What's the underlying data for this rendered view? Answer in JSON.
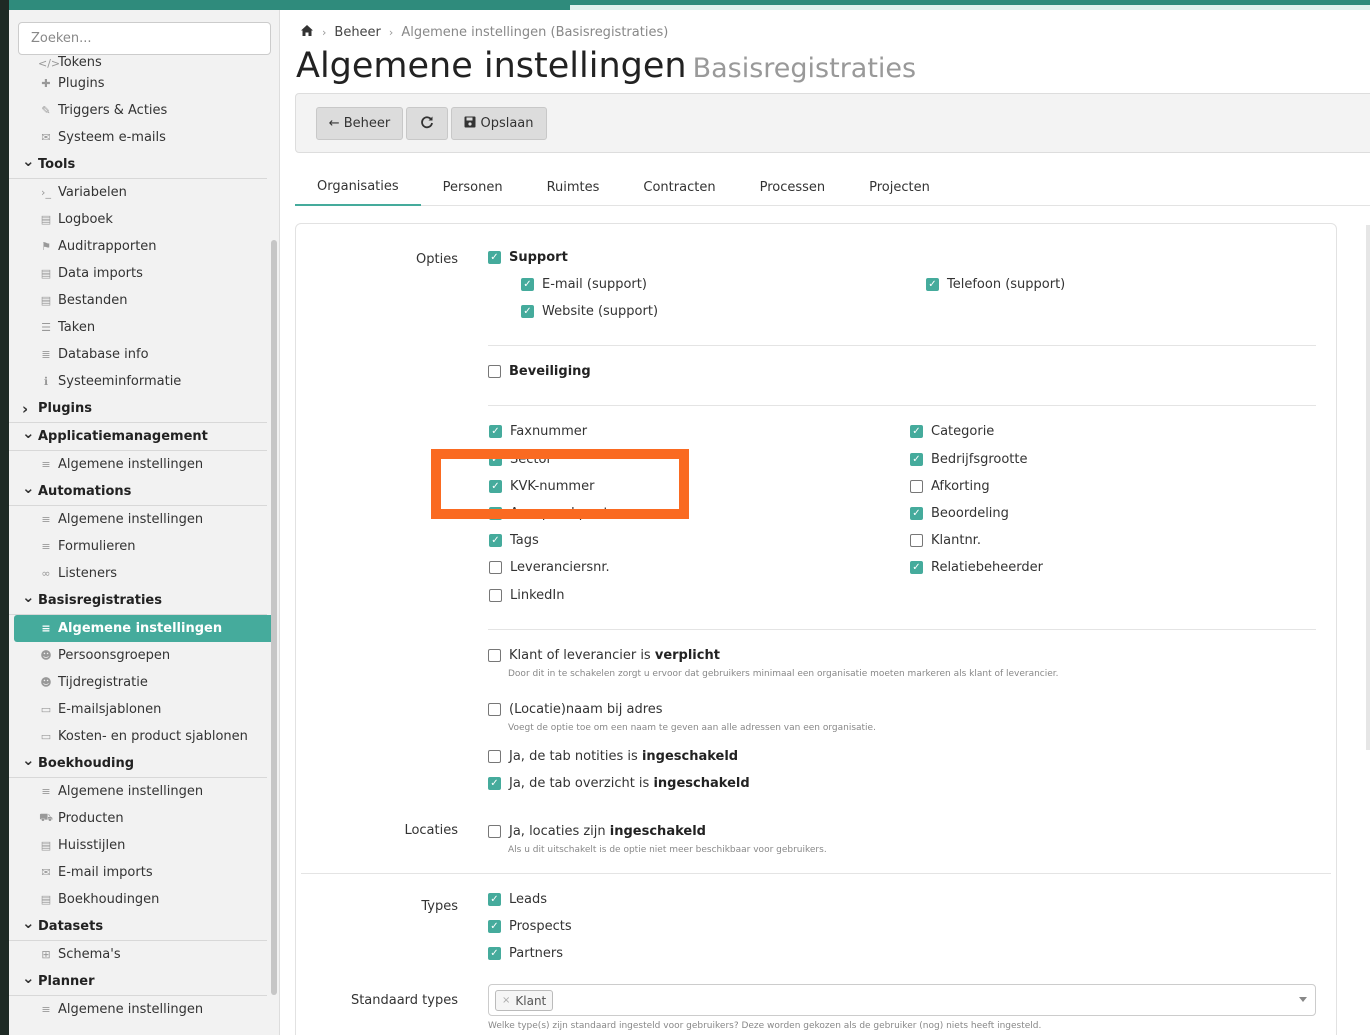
{
  "sidebar": {
    "search_placeholder": "Zoeken...",
    "items": [
      {
        "kind": "item",
        "icon": "code-icon",
        "glyph": "</>",
        "label": "Tokens"
      },
      {
        "kind": "item",
        "icon": "puzzle-icon",
        "glyph": "✚",
        "label": "Plugins"
      },
      {
        "kind": "item",
        "icon": "pencil-icon",
        "glyph": "✎",
        "label": "Triggers & Acties"
      },
      {
        "kind": "item",
        "icon": "mail-bulk-icon",
        "glyph": "✉",
        "label": "Systeem e-mails"
      },
      {
        "kind": "section",
        "expanded": true,
        "label": "Tools"
      },
      {
        "kind": "item",
        "icon": "terminal-icon",
        "glyph": "›_",
        "label": "Variabelen"
      },
      {
        "kind": "item",
        "icon": "book-icon",
        "glyph": "▤",
        "label": "Logboek"
      },
      {
        "kind": "item",
        "icon": "flag-icon",
        "glyph": "⚑",
        "label": "Auditrapporten"
      },
      {
        "kind": "item",
        "icon": "file-import-icon",
        "glyph": "▤",
        "label": "Data imports"
      },
      {
        "kind": "item",
        "icon": "file-icon",
        "glyph": "▤",
        "label": "Bestanden"
      },
      {
        "kind": "item",
        "icon": "task-list-icon",
        "glyph": "☰",
        "label": "Taken"
      },
      {
        "kind": "item",
        "icon": "database-icon",
        "glyph": "≣",
        "label": "Database info"
      },
      {
        "kind": "item",
        "icon": "info-icon",
        "glyph": "ℹ",
        "label": "Systeeminformatie"
      },
      {
        "kind": "section",
        "expanded": false,
        "label": "Plugins"
      },
      {
        "kind": "section",
        "expanded": true,
        "label": "Applicatiemanagement"
      },
      {
        "kind": "item",
        "icon": "sliders-icon",
        "glyph": "≡",
        "label": "Algemene instellingen"
      },
      {
        "kind": "section",
        "expanded": true,
        "label": "Automations"
      },
      {
        "kind": "item",
        "icon": "sliders-icon",
        "glyph": "≡",
        "label": "Algemene instellingen"
      },
      {
        "kind": "item",
        "icon": "form-icon",
        "glyph": "≡",
        "label": "Formulieren"
      },
      {
        "kind": "item",
        "icon": "link-icon",
        "glyph": "∞",
        "label": "Listeners"
      },
      {
        "kind": "section",
        "expanded": true,
        "label": "Basisregistraties"
      },
      {
        "kind": "item",
        "icon": "sliders-icon",
        "glyph": "≡",
        "label": "Algemene instellingen",
        "active": true
      },
      {
        "kind": "item",
        "icon": "users-icon",
        "glyph": "☻",
        "label": "Persoonsgroepen"
      },
      {
        "kind": "item",
        "icon": "user-clock-icon",
        "glyph": "☻",
        "label": "Tijdregistratie"
      },
      {
        "kind": "item",
        "icon": "envelope-template-icon",
        "glyph": "▭",
        "label": "E-mailsjablonen"
      },
      {
        "kind": "item",
        "icon": "template-icon",
        "glyph": "▭",
        "label": "Kosten- en product sjablonen"
      },
      {
        "kind": "section",
        "expanded": true,
        "label": "Boekhouding"
      },
      {
        "kind": "item",
        "icon": "sliders-icon",
        "glyph": "≡",
        "label": "Algemene instellingen"
      },
      {
        "kind": "item",
        "icon": "cart-icon",
        "glyph": "⛟",
        "label": "Producten"
      },
      {
        "kind": "item",
        "icon": "file-brush-icon",
        "glyph": "▤",
        "label": "Huisstijlen"
      },
      {
        "kind": "item",
        "icon": "mail-bulk-icon",
        "glyph": "✉",
        "label": "E-mail imports"
      },
      {
        "kind": "item",
        "icon": "ledger-icon",
        "glyph": "▤",
        "label": "Boekhoudingen"
      },
      {
        "kind": "section",
        "expanded": true,
        "label": "Datasets"
      },
      {
        "kind": "item",
        "icon": "table-icon",
        "glyph": "⊞",
        "label": "Schema's"
      },
      {
        "kind": "section",
        "expanded": true,
        "label": "Planner"
      },
      {
        "kind": "item",
        "icon": "sliders-icon",
        "glyph": "≡",
        "label": "Algemene instellingen"
      }
    ]
  },
  "breadcrumb": {
    "home_icon": "home-icon",
    "level1": "Beheer",
    "current": "Algemene instellingen (Basisregistraties)"
  },
  "title": {
    "main": "Algemene instellingen",
    "sub": "Basisregistraties"
  },
  "toolbar": {
    "back_label": "Beheer",
    "refresh_icon": "refresh-icon",
    "save_label": "Opslaan"
  },
  "tabs": [
    "Organisaties",
    "Personen",
    "Ruimtes",
    "Contracten",
    "Processen",
    "Projecten"
  ],
  "form": {
    "opties_label": "Opties",
    "support": {
      "label": "Support",
      "checked": true
    },
    "email_support": {
      "label": "E-mail (support)",
      "checked": true
    },
    "telefoon_support": {
      "label": "Telefoon (support)",
      "checked": true
    },
    "website_support": {
      "label": "Website (support)",
      "checked": true
    },
    "beveiliging": {
      "label": "Beveiliging",
      "checked": false
    },
    "fields_left": [
      {
        "label": "Faxnummer",
        "checked": true
      },
      {
        "label": "Sector",
        "checked": true
      },
      {
        "label": "KVK-nummer",
        "checked": true
      },
      {
        "label": "Aanspreekpunt",
        "checked": true
      },
      {
        "label": "Tags",
        "checked": true
      },
      {
        "label": "Leveranciersnr.",
        "checked": false
      },
      {
        "label": "LinkedIn",
        "checked": false
      }
    ],
    "fields_right": [
      {
        "label": "Categorie",
        "checked": true
      },
      {
        "label": "Bedrijfsgrootte",
        "checked": true
      },
      {
        "label": "Afkorting",
        "checked": false
      },
      {
        "label": "Beoordeling",
        "checked": true
      },
      {
        "label": "Klantnr.",
        "checked": false
      },
      {
        "label": "Relatiebeheerder",
        "checked": true
      }
    ],
    "klant_lev": {
      "prefix": "Klant of leverancier is ",
      "bold": "verplicht",
      "checked": false,
      "help": "Door dit in te schakelen zorgt u ervoor dat gebruikers minimaal een organisatie moeten markeren als klant of leverancier."
    },
    "locatienaam": {
      "label": "(Locatie)naam bij adres",
      "checked": false,
      "help": "Voegt de optie toe om een naam te geven aan alle adressen van een organisatie."
    },
    "tab_notities": {
      "prefix": "Ja, de tab notities is ",
      "bold": "ingeschakeld",
      "checked": false
    },
    "tab_overzicht": {
      "prefix": "Ja, de tab overzicht is ",
      "bold": "ingeschakeld",
      "checked": true
    },
    "locaties_label": "Locaties",
    "locaties": {
      "prefix": "Ja, locaties zijn ",
      "bold": "ingeschakeld",
      "checked": false,
      "help": "Als u dit uitschakelt is de optie niet meer beschikbaar voor gebruikers."
    },
    "types_label": "Types",
    "types": [
      {
        "label": "Leads",
        "checked": true
      },
      {
        "label": "Prospects",
        "checked": true
      },
      {
        "label": "Partners",
        "checked": true
      }
    ],
    "standaard_label": "Standaard types",
    "standaard_tag": "Klant",
    "standaard_help": "Welke type(s) zijn standaard ingesteld voor gebruikers? Deze worden gekozen als de gebruiker (nog) niets heeft ingesteld."
  },
  "colors": {
    "accent": "#45ab9c",
    "highlight": "#fa6a21"
  }
}
